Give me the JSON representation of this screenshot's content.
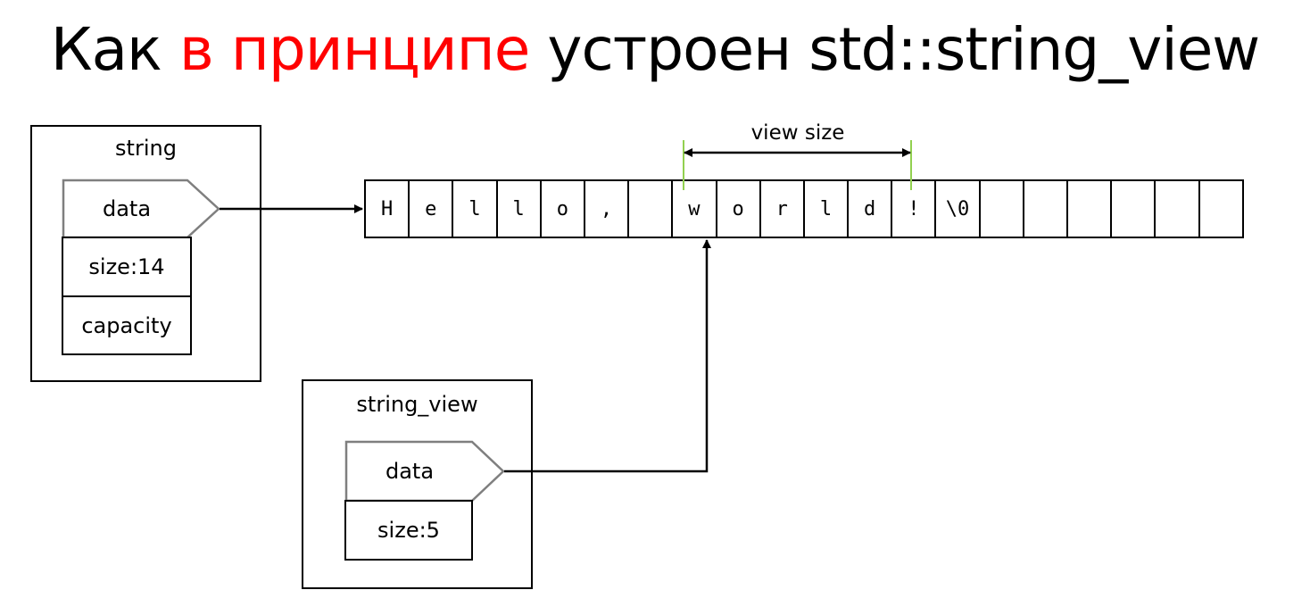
{
  "title": {
    "part1": "Как ",
    "part2": "в принципе",
    "part3": " устроен std::string_view"
  },
  "string_box": {
    "label": "string",
    "fields": {
      "data": "data",
      "size": "size:14",
      "capacity": "capacity"
    }
  },
  "string_view_box": {
    "label": "string_view",
    "fields": {
      "data": "data",
      "size": "size:5"
    }
  },
  "char_array": [
    "H",
    "e",
    "l",
    "l",
    "o",
    ",",
    "",
    "w",
    "o",
    "r",
    "l",
    "d",
    "!",
    "\\0",
    "",
    "",
    "",
    "",
    "",
    ""
  ],
  "view_size_label": "view size",
  "colors": {
    "accent": "#ff0000",
    "pointer_field_border": "#7f7f7f",
    "marker_line": "#92d050"
  }
}
